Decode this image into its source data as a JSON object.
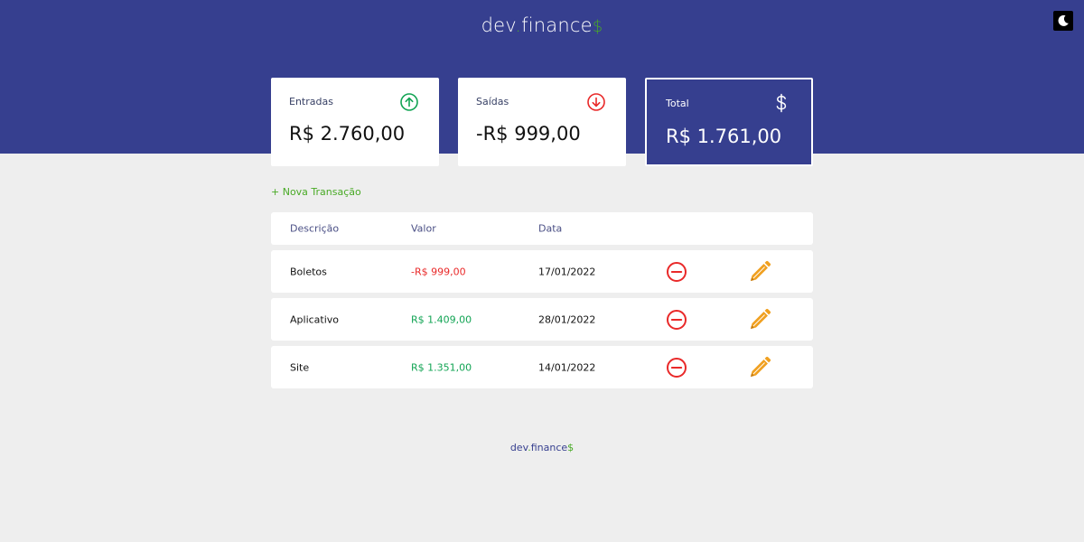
{
  "header": {
    "logo_main": "dev",
    "logo_dot": ".",
    "logo_suffix": "finance",
    "logo_currency": "$",
    "theme_icon": "moon-icon"
  },
  "summary": {
    "income": {
      "label": "Entradas",
      "value": "R$ 2.760,00",
      "icon": "arrow-up-circle-icon",
      "color": "#12a454"
    },
    "expense": {
      "label": "Saídas",
      "value": "-R$ 999,00",
      "icon": "arrow-down-circle-icon",
      "color": "#e92929"
    },
    "total": {
      "label": "Total",
      "value": "R$ 1.761,00",
      "icon": "dollar-icon"
    }
  },
  "new_transaction_label": "+ Nova Transação",
  "table": {
    "columns": [
      "Descrição",
      "Valor",
      "Data"
    ],
    "rows": [
      {
        "description": "Boletos",
        "amount": "-R$ 999,00",
        "date": "17/01/2022",
        "type": "expense"
      },
      {
        "description": "Aplicativo",
        "amount": "R$ 1.409,00",
        "date": "28/01/2022",
        "type": "income"
      },
      {
        "description": "Site",
        "amount": "R$ 1.351,00",
        "date": "14/01/2022",
        "type": "income"
      }
    ],
    "remove_icon": "minus-circle-icon",
    "edit_icon": "pencil-icon"
  },
  "footer": {
    "logo_main": "dev",
    "logo_dot": ".",
    "logo_suffix": "finance",
    "logo_currency": "$"
  },
  "colors": {
    "brand": "#363f8f",
    "income": "#12a454",
    "expense": "#e92929",
    "accent": "#49aa26",
    "edit": "#f0a020"
  }
}
